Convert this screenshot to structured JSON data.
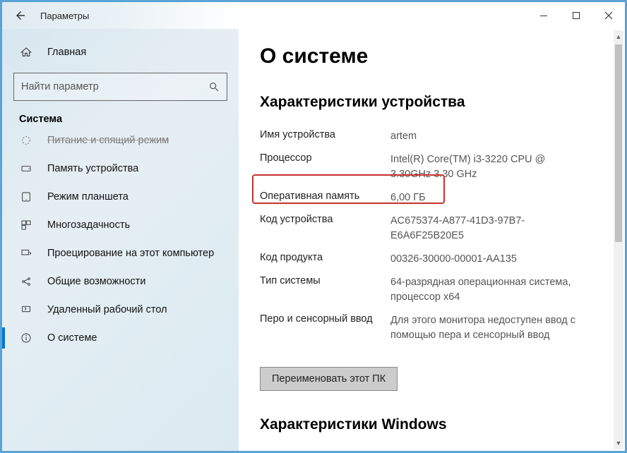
{
  "titlebar": {
    "title": "Параметры"
  },
  "sidebar": {
    "home": "Главная",
    "search_placeholder": "Найти параметр",
    "section": "Система",
    "items": [
      {
        "label": "Питание и спящий режим"
      },
      {
        "label": "Память устройства"
      },
      {
        "label": "Режим планшета"
      },
      {
        "label": "Многозадачность"
      },
      {
        "label": "Проецирование на этот компьютер"
      },
      {
        "label": "Общие возможности"
      },
      {
        "label": "Удаленный рабочий стол"
      },
      {
        "label": "О системе"
      }
    ]
  },
  "main": {
    "page_title": "О системе",
    "device_specs_title": "Характеристики устройства",
    "specs": [
      {
        "label": "Имя устройства",
        "value": "artem"
      },
      {
        "label": "Процессор",
        "value": "Intel(R) Core(TM) i3-3220 CPU @ 3.30GHz   3.30 GHz"
      },
      {
        "label": "Оперативная память",
        "value": "6,00 ГБ"
      },
      {
        "label": "Код устройства",
        "value": "AC675374-A877-41D3-97B7-E6A6F25B20E5"
      },
      {
        "label": "Код продукта",
        "value": "00326-30000-00001-AA135"
      },
      {
        "label": "Тип системы",
        "value": "64-разрядная операционная система, процессор x64"
      },
      {
        "label": "Перо и сенсорный ввод",
        "value": "Для этого монитора недоступен ввод с помощью пера и сенсорный ввод"
      }
    ],
    "rename_button": "Переименовать этот ПК",
    "windows_specs_title": "Характеристики Windows"
  }
}
